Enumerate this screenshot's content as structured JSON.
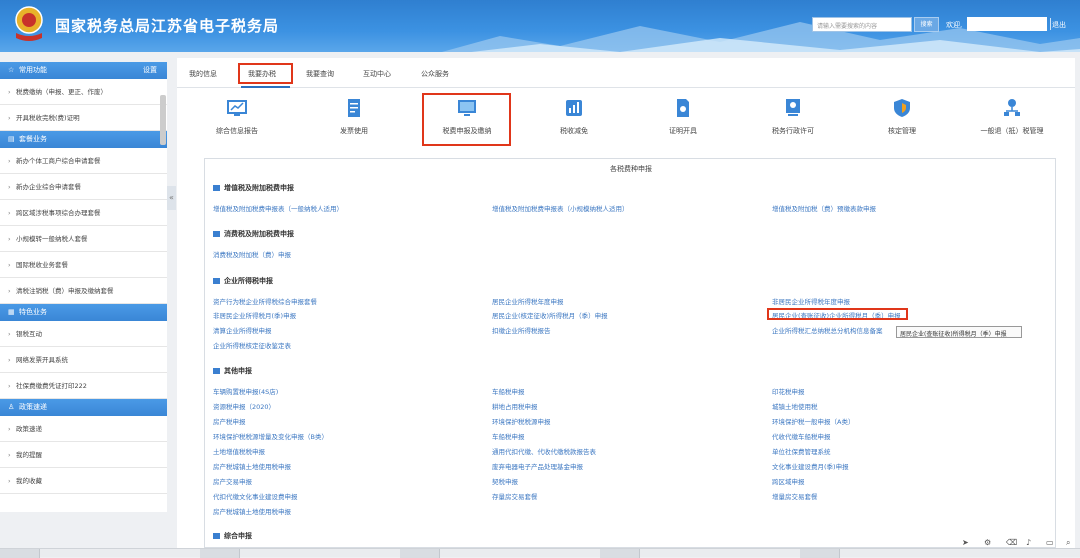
{
  "header": {
    "title": "国家税务总局江苏省电子税务局",
    "search_placeholder": "请输入需要搜索的内容",
    "search_button": "搜索",
    "welcome": "欢迎,",
    "logout": "退出",
    "logo_text": "CHINA TAX"
  },
  "sidebar": {
    "common": {
      "title": "常用功能",
      "settings": "设置",
      "items": [
        "税费缴纳（申报、更正、作废）",
        "开具税收完税(费)证明"
      ]
    },
    "bundle": {
      "title": "套餐业务",
      "items": [
        "新办个体工商户综合申请套餐",
        "新办企业综合申请套餐",
        "跨区域涉税事项综合办理套餐",
        "小规模转一般纳税人套餐",
        "国际税收业务套餐",
        "清税注销税（费）申报及缴纳套餐"
      ]
    },
    "special": {
      "title": "特色业务",
      "items": [
        "银税互动",
        "网络发票开具系统",
        "社保费缴费凭证打印222"
      ]
    },
    "policy": {
      "title": "政策速递",
      "items": [
        "政策速递",
        "我的提醒",
        "我的收藏"
      ]
    }
  },
  "tabs": [
    "我的信息",
    "我要办税",
    "我要查询",
    "互动中心",
    "公众服务"
  ],
  "tiles": [
    {
      "label": "综合信息报告",
      "icon": "monitor-chart-icon",
      "color": "#3a86d6"
    },
    {
      "label": "发票使用",
      "icon": "invoice-icon",
      "color": "#3a86d6"
    },
    {
      "label": "税费申报及缴纳",
      "icon": "computer-icon",
      "color": "#3a86d6"
    },
    {
      "label": "税收减免",
      "icon": "bar-chart-icon",
      "color": "#3a86d6"
    },
    {
      "label": "证明开具",
      "icon": "certificate-icon",
      "color": "#3a86d6"
    },
    {
      "label": "税务行政许可",
      "icon": "badge-icon",
      "color": "#3a86d6"
    },
    {
      "label": "核定管理",
      "icon": "shield-icon",
      "color": "#f0a020"
    },
    {
      "label": "一般退（抵）税管理",
      "icon": "org-tree-icon",
      "color": "#3a86d6"
    }
  ],
  "panel": {
    "title": "各税费种申报",
    "sections": [
      {
        "title": "增值税及附加税费申报",
        "links": [
          "增值税及附加税费申报表（一般纳税人适用）",
          "增值税及附加税费申报表（小规模纳税人适用）",
          "增值税及附加税（费）预缴表款申报"
        ]
      },
      {
        "title": "消费税及附加税费申报",
        "links": [
          "消费税及附加税（费）申报"
        ]
      },
      {
        "title": "企业所得税申报",
        "links": [
          "资产行为税企业所得税综合申报套餐",
          "居民企业所得税年度申报",
          "非居民企业所得税月(季)申报",
          "非居民企业所得税年度申报",
          "居民企业(核定征收)所得税月（季）申报",
          "居民企业(查账征收)企业所得税月（季）申报",
          "清算企业所得税申报",
          "扣缴企业所得税报告",
          "企业所得税汇总纳税总分机构信息备案",
          "企业所得税核定征收鉴定表"
        ]
      },
      {
        "title": "其他申报",
        "links": [
          "车辆购置税申报(4S店)",
          "车船税申报",
          "印花税申报",
          "资源税申报（2020）",
          "耕地占用税申报",
          "城镇土地使用税",
          "房产税申报",
          "环境保护税税源申报",
          "环境保护税一般申报（A类）",
          "环境保护税税源增量及变化申报（B类）",
          "车船税申报",
          "代收代缴车船税申报",
          "土地增值税税申报",
          "通用代扣代缴、代收代缴税款报告表",
          "单位社保费管理系统",
          "房产税城镇土地使用税申报",
          "废弃电器电子产品处理基金申报",
          "文化事业建设费月(季)申报",
          "房产交易申报",
          "契税申报",
          "跨区域申报",
          "代扣代缴文化事业建设费申报",
          "存量房交易套餐",
          "增量房交易套餐",
          "房产税城镇土地使用税申报"
        ]
      },
      {
        "title": "综合申报",
        "links": []
      }
    ],
    "tooltip": "居民企业(查账征收)所得税月（季）申报"
  }
}
